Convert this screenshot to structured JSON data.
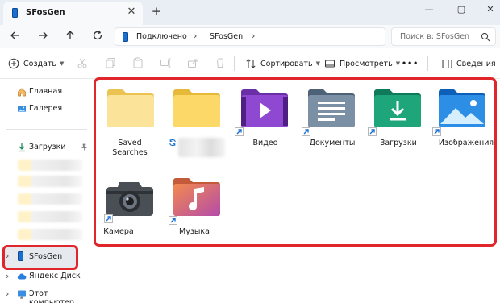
{
  "window": {
    "tab_title": "SFosGen",
    "tab_close": "✕",
    "new_tab": "+",
    "minimize": "—",
    "maximize": "▢",
    "close": "✕"
  },
  "address_bar": {
    "crumbs": [
      "Подключено",
      "SFosGen"
    ],
    "separator": "›",
    "search_placeholder": "Поиск в: SFosGen"
  },
  "toolbar": {
    "create": "Создать",
    "sort": "Сортировать",
    "view": "Просмотреть",
    "more": "•••",
    "details": "Сведения"
  },
  "sidebar": {
    "home": "Главная",
    "gallery": "Галерея",
    "downloads": "Загрузки",
    "device": "SFosGen",
    "yandex_disk": "Яндекс Диск",
    "this_pc": "Этот компьютер",
    "expand_glyph": "›"
  },
  "items": [
    {
      "name": "Saved\nSearches",
      "icon": "folder-plain-icon"
    },
    {
      "name": "",
      "icon": "folder-synced-icon",
      "label_hidden": true
    },
    {
      "name": "Видео",
      "icon": "folder-video-icon"
    },
    {
      "name": "Документы",
      "icon": "folder-documents-icon"
    },
    {
      "name": "Загрузки",
      "icon": "folder-downloads-icon"
    },
    {
      "name": "Изображения",
      "icon": "folder-pictures-icon"
    },
    {
      "name": "Камера",
      "icon": "camera-icon"
    },
    {
      "name": "Музыка",
      "icon": "folder-music-icon"
    }
  ],
  "colors": {
    "highlight": "#e0262b",
    "accent": "#1a6fd1"
  }
}
